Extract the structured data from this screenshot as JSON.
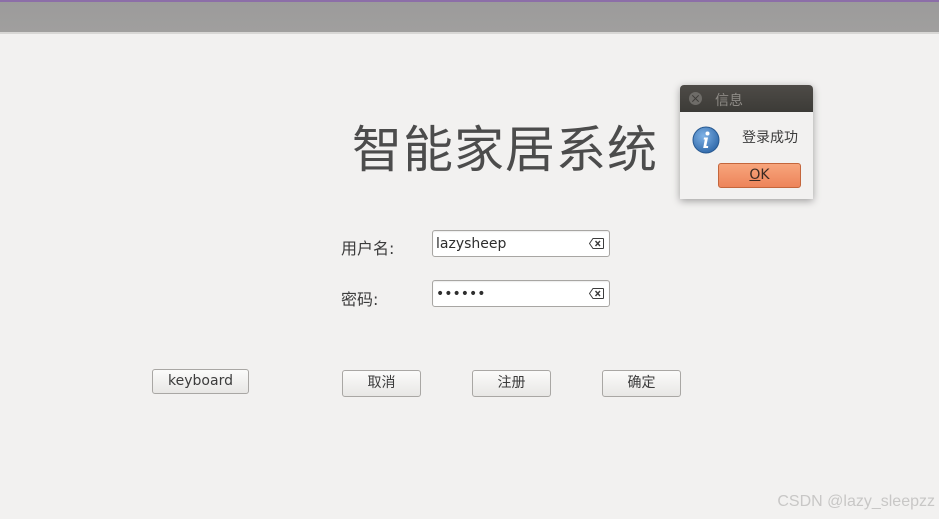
{
  "window": {
    "title": "智能家居系统"
  },
  "form": {
    "username_label": "用户名:",
    "username_value": "lazysheep",
    "password_label": "密码:",
    "password_value": "••••••"
  },
  "buttons": {
    "keyboard": "keyboard",
    "cancel": "取消",
    "register": "注册",
    "confirm": "确定"
  },
  "dialog": {
    "title": "信息",
    "message": "登录成功",
    "ok_mnemonic": "O",
    "ok_rest": "K",
    "icon": "info-icon"
  },
  "watermark": "CSDN @lazy_sleepzz",
  "colors": {
    "accent": "#ef8b62",
    "titlebar": "#3c3b37",
    "background": "#f2f1f0"
  }
}
